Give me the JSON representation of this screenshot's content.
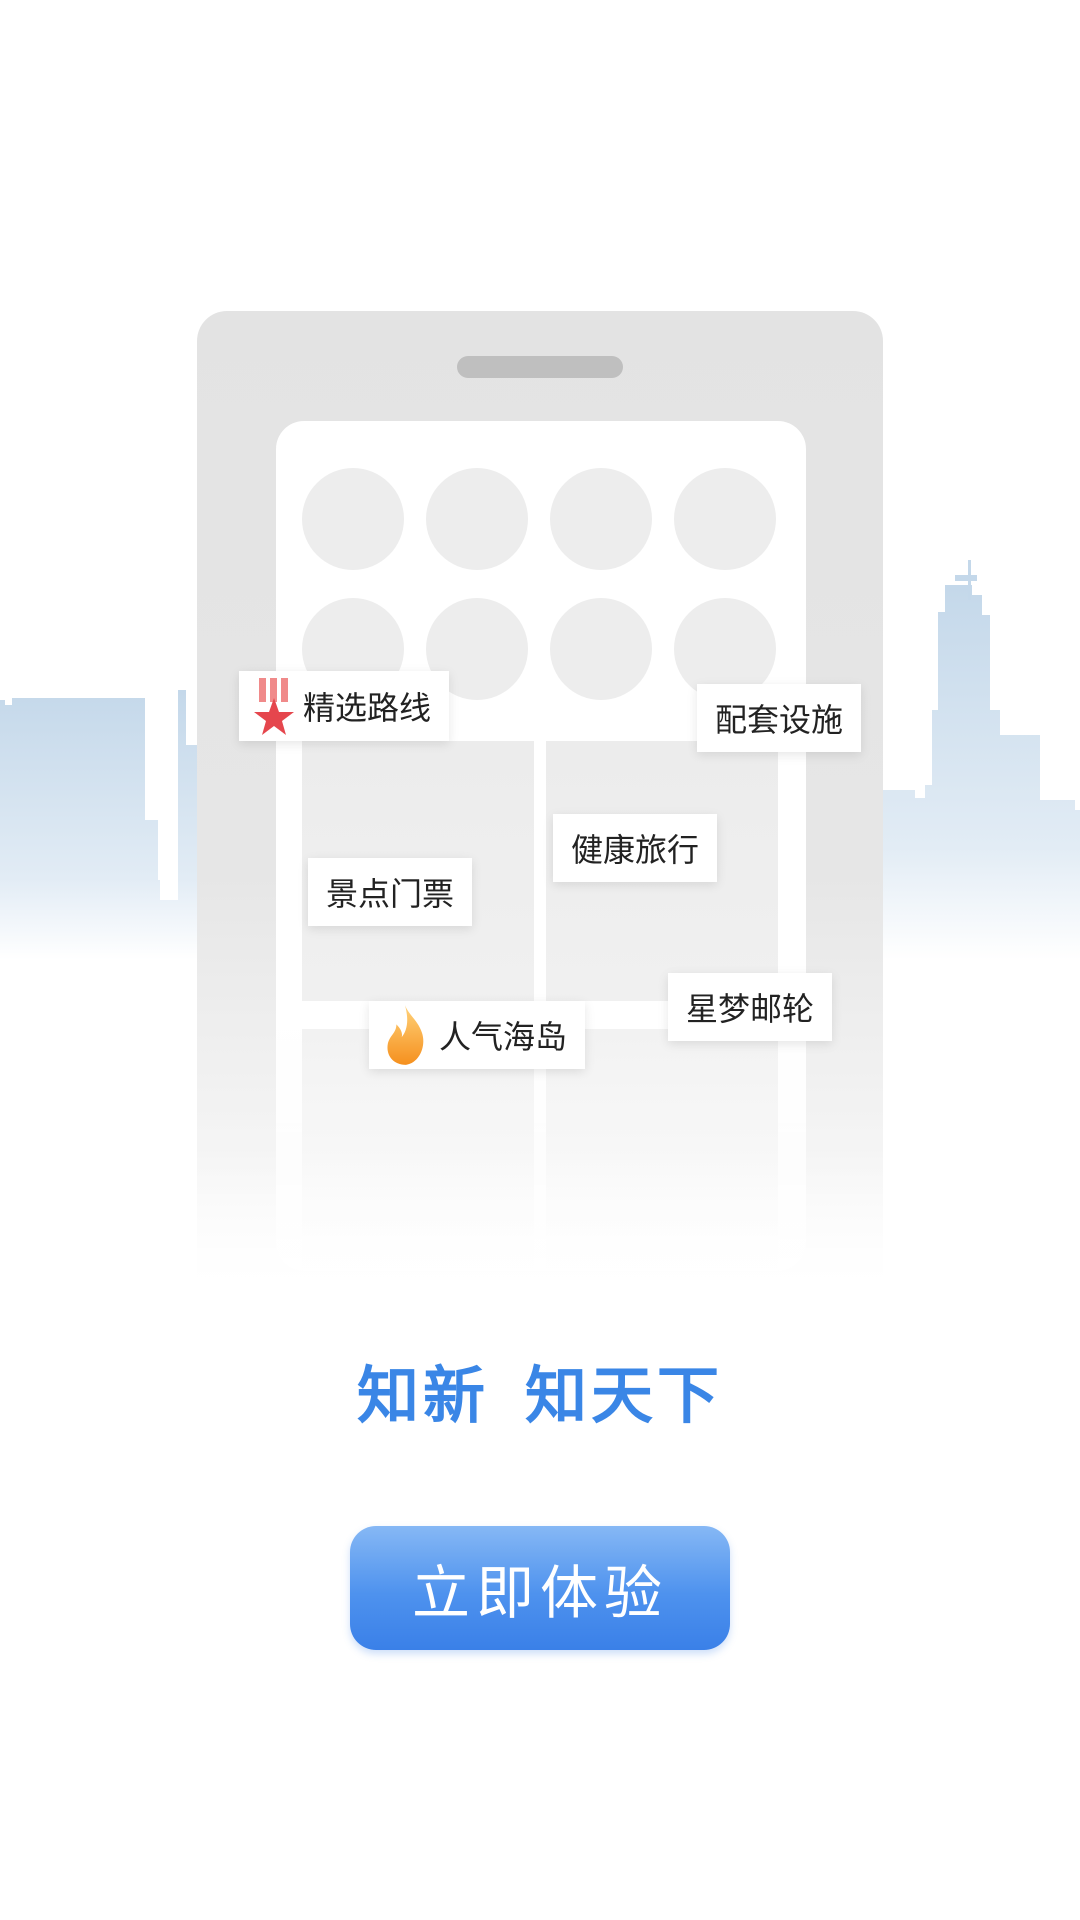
{
  "tags": {
    "featured_routes": "精选路线",
    "facilities": "配套设施",
    "health_travel": "健康旅行",
    "tickets": "景点门票",
    "popular_islands": "人气海岛",
    "cruise": "星梦邮轮"
  },
  "icons": {
    "featured_routes": "medal-star-icon",
    "popular_islands": "flame-icon"
  },
  "slogan": {
    "part1": "知新",
    "part2": "知天下"
  },
  "cta": {
    "label": "立即体验"
  },
  "colors": {
    "accent": "#3a86e6",
    "skyline": "#c9dbea",
    "phone_body": "#e3e3e3"
  }
}
